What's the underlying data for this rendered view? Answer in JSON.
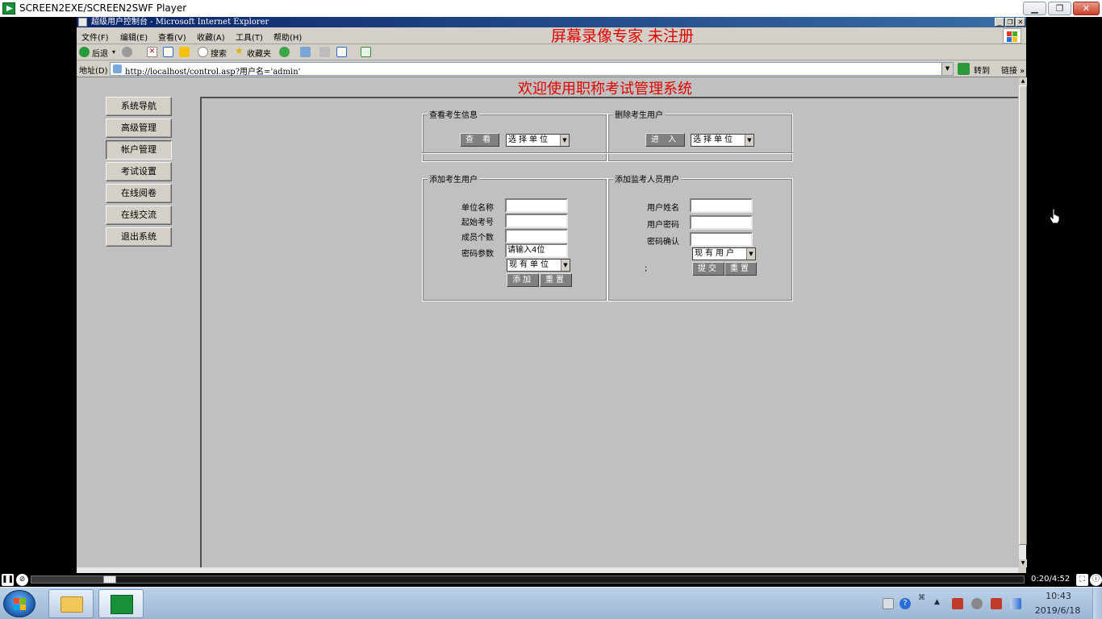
{
  "player": {
    "title": "SCREEN2EXE/SCREEN2SWF Player",
    "time": "0:20/4:52",
    "progress_fraction": 0.072
  },
  "ie": {
    "title": "超级用户控制台 - Microsoft Internet Explorer",
    "banner": "屏幕录像专家  未注册",
    "menu": [
      "文件(F)",
      "编辑(E)",
      "查看(V)",
      "收藏(A)",
      "工具(T)",
      "帮助(H)"
    ],
    "toolbar": {
      "back": "后退",
      "search": "搜索",
      "favorites": "收藏夹"
    },
    "address_label": "地址(D)",
    "address": "http://localhost/control.asp?用户名='admin'",
    "go": "转到",
    "links": "链接 »"
  },
  "page": {
    "title": "欢迎使用职称考试管理系统",
    "nav": [
      "系统导航",
      "高级管理",
      "帐户管理",
      "考试设置",
      "在线阅卷",
      "在线交流",
      "退出系统"
    ],
    "view_examinee": {
      "legend": "查看考生信息",
      "button": "查 看",
      "select": "选择单位"
    },
    "delete_examinee": {
      "legend": "删除考生用户",
      "button": "进 入",
      "select": "选择单位"
    },
    "add_examinee": {
      "legend": "添加考生用户",
      "labels": [
        "单位名称",
        "起始考号",
        "成员个数",
        "密码参数"
      ],
      "values": [
        "",
        "",
        "",
        "请输入4位"
      ],
      "select": "现有单位",
      "add": "添加",
      "reset": "重置"
    },
    "add_proctor": {
      "legend": "添加监考人员用户",
      "labels": [
        "用户姓名",
        "用户密码",
        "密码确认"
      ],
      "select": "现有用户",
      "stray": ";",
      "submit": "提交",
      "reset": "重置"
    }
  },
  "taskbar": {
    "time": "10:43",
    "date": "2019/6/18"
  }
}
